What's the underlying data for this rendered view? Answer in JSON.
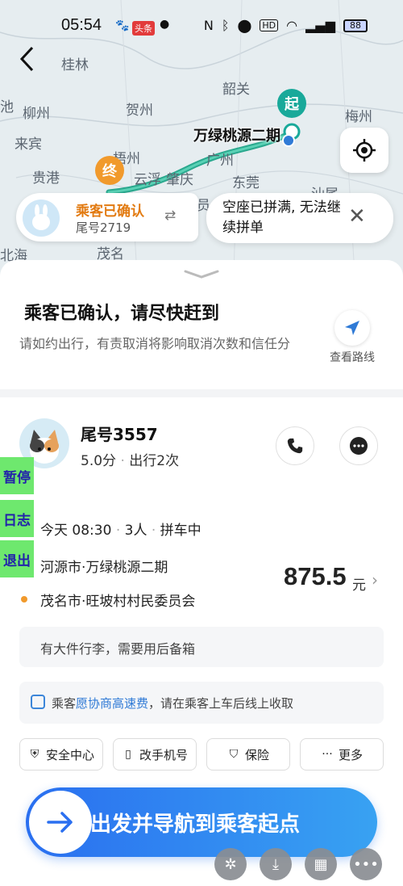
{
  "status_bar": {
    "time": "05:54",
    "badge": "头条",
    "battery": "88"
  },
  "map": {
    "labels": [
      "桂林",
      "柳州",
      "贺州",
      "来宾",
      "梧州",
      "贵港",
      "云浮",
      "肇庆",
      "广州",
      "东莞",
      "韶关",
      "梅州",
      "汕尾",
      "茂名",
      "池",
      "北海"
    ],
    "origin_label": "万绿桃源二期",
    "start_pin": "起",
    "end_pin": "终",
    "partial_label": "民委员"
  },
  "passenger_tag": {
    "status": "乘客已确认",
    "tail": "尾号2719"
  },
  "toast": {
    "message": "空座已拼满, 无法继续拼单"
  },
  "header": {
    "title": "乘客已确认，请尽快赶到",
    "subtitle": "请如约出行，有责取消将影响取消次数和信任分",
    "route_button": "查看路线"
  },
  "passenger": {
    "tail": "尾号3557",
    "rating": "5.0分",
    "trips": "出行2次"
  },
  "trip": {
    "time": "今天 08:30",
    "seats": "3人",
    "mode": "拼车中",
    "from": "河源市·万绿桃源二期",
    "to": "茂名市·旺坡村村民委员会",
    "price": "875.5",
    "price_unit": "元"
  },
  "note": "有大件行李，需要用后备箱",
  "fee": {
    "prefix": "乘客",
    "highlight": "愿协商高速费",
    "suffix": "，请在乘客上车后线上收取"
  },
  "chips": [
    "安全中心",
    "改手机号",
    "保险",
    "更多"
  ],
  "nav_button": "出发并导航到乘客起点",
  "side_buttons": [
    "暂停",
    "日志",
    "退出"
  ]
}
